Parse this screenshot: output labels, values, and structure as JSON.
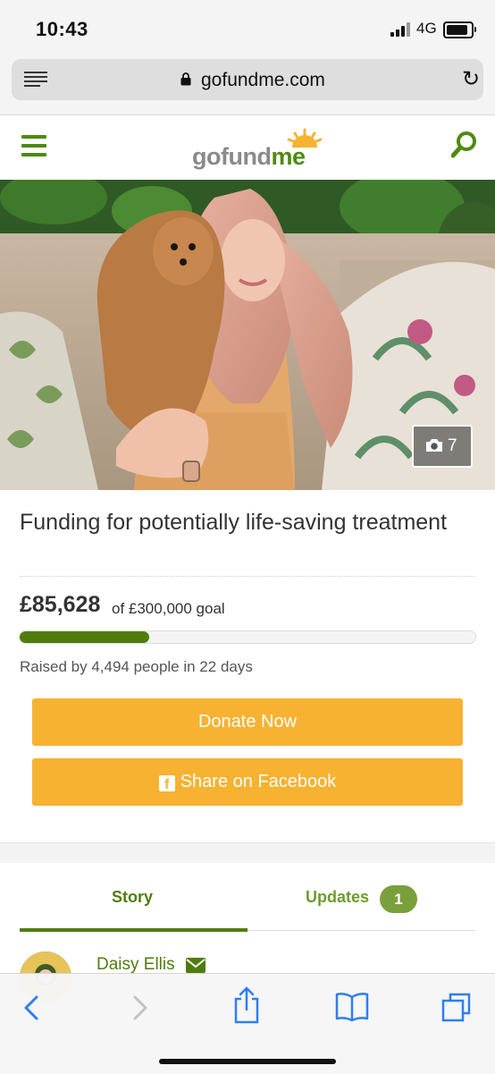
{
  "status_bar": {
    "time": "10:43",
    "network": "4G"
  },
  "browser": {
    "url": "gofundme.com"
  },
  "site": {
    "logo_go": "gofund",
    "logo_me": "me"
  },
  "hero": {
    "photo_count": "7"
  },
  "campaign": {
    "title": "Funding for potentially life-saving treatment",
    "raised": "£85,628",
    "goal_text": "of £300,000 goal",
    "progress_fraction": 0.285,
    "raised_by": "Raised by 4,494 people in 22 days",
    "donate_label": "Donate Now",
    "share_label": "Share on Facebook"
  },
  "tabs": {
    "story": "Story",
    "updates": "Updates",
    "updates_count": "1"
  },
  "organizer": {
    "name": "Daisy Ellis"
  },
  "colors": {
    "brand_green": "#4f7d0c",
    "button_orange": "#f7b232"
  }
}
